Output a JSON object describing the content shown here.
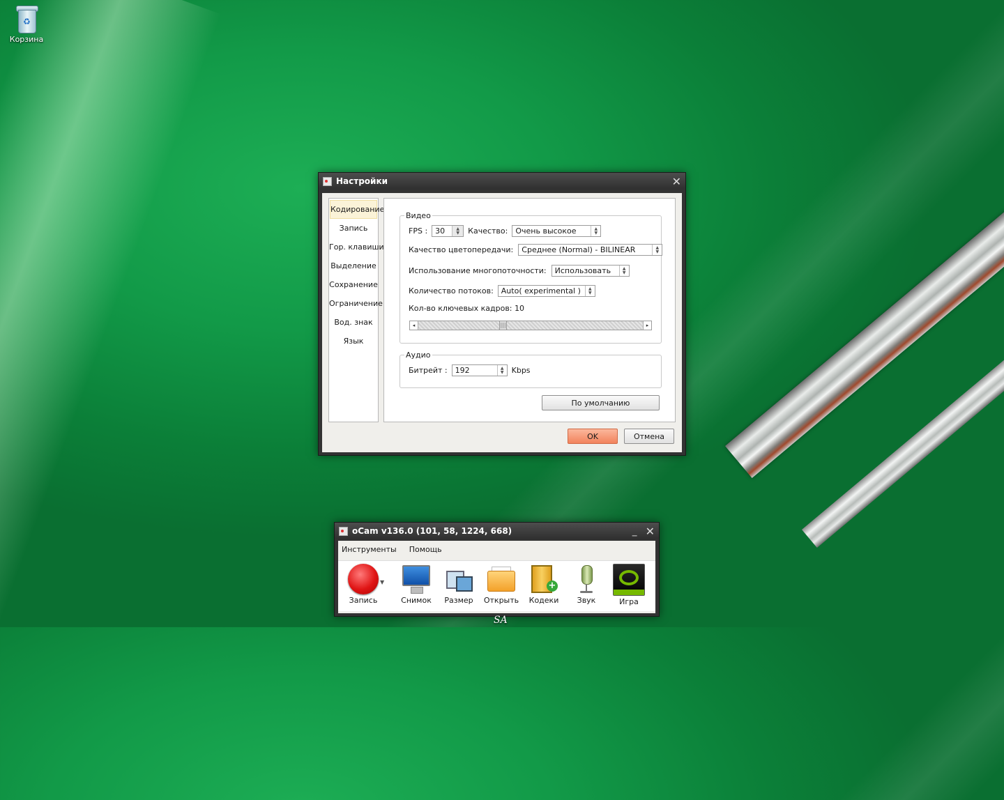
{
  "desktop": {
    "recycle_bin_label": "Корзина",
    "watermark": "SA"
  },
  "settings": {
    "title": "Настройки",
    "sidebar": [
      "Кодирование",
      "Запись",
      "Гор. клавиши",
      "Выделение",
      "Сохранение",
      "Ограничение",
      "Вод. знак",
      "Язык"
    ],
    "video": {
      "legend": "Видео",
      "fps_label": "FPS :",
      "fps_value": "30",
      "quality_label": "Качество:",
      "quality_value": "Очень высокое",
      "color_label": "Качество цветопередачи:",
      "color_value": "Среднее (Normal) - BILINEAR",
      "mt_label": "Использование многопоточности:",
      "mt_value": "Использовать",
      "threads_label": "Количество потоков:",
      "threads_value": "Auto( experimental )",
      "keyframes_label": "Кол-во ключевых кадров: 10"
    },
    "audio": {
      "legend": "Аудио",
      "bitrate_label": "Битрейт :",
      "bitrate_value": "192",
      "bitrate_unit": "Kbps"
    },
    "default_button": "По умолчанию",
    "ok_button": "OK",
    "cancel_button": "Отмена"
  },
  "ocam": {
    "title": "oCam v136.0 (101, 58, 1224, 668)",
    "menu": [
      "Инструменты",
      "Помощь"
    ],
    "tools": [
      "Запись",
      "Снимок",
      "Размер",
      "Открыть",
      "Кодеки",
      "Звук",
      "Игра"
    ]
  }
}
